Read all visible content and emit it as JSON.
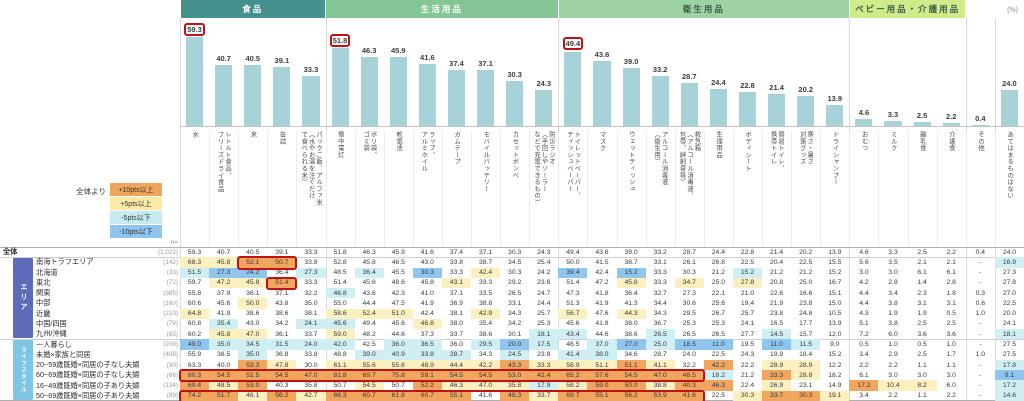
{
  "unit_label": "(%)",
  "n_label": "n=",
  "legend": {
    "prefix": "全体より",
    "items": [
      {
        "label": "+10pts以上",
        "color": "#f0a55c"
      },
      {
        "label": "+5pts以上",
        "color": "#fbe9a5"
      },
      {
        "label": "-5pts以下",
        "color": "#c3ebf1"
      },
      {
        "label": "-10pts以下",
        "color": "#8fc6f0"
      }
    ]
  },
  "chart_data": {
    "type": "bar",
    "unit": "%",
    "bar_color": "#a6d2d8",
    "annotation_color": "#bd1315",
    "groups": [
      {
        "label": "食品",
        "start": 0,
        "end": 4,
        "color": "#44918e",
        "text_color": "#ffffff"
      },
      {
        "label": "生活用品",
        "start": 5,
        "end": 12,
        "color": "#83c694",
        "text_color": "#ffffff"
      },
      {
        "label": "衛生用品",
        "start": 13,
        "end": 22,
        "color": "#9dd3a3",
        "text_color": "#3e5b45"
      },
      {
        "label": "ベビー用品・介護用品",
        "start": 23,
        "end": 26,
        "color": "#cfec8b",
        "text_color": "#3e5b45"
      }
    ],
    "categories": [
      "水",
      "レトルト食品、\nフリーズドライ食品",
      "米",
      "缶詰",
      "パックご飯、アルファ米\n（水やお湯を注ぐだけ\nで食べられる米）",
      "懐中電灯",
      "ポリ袋、\nゴミ袋",
      "乾電池",
      "ラップ、\nアルミホイル",
      "ガムテープ",
      "モバイルバッテリー",
      "カセットボンベ",
      "防災ラジオ\n（手回しやソーラー\nなどで充電できるもの）",
      "トイレットペーパー、\nティッシュペーパー",
      "マスク",
      "ウェットティッシュ",
      "アルコール消毒液\n（衛生用）",
      "救急箱\n（アルコール消毒液、\n包帯、絆創膏等）",
      "生理用品",
      "ボディシート",
      "簡易トイレ、\n携帯トイレ",
      "寒さ・暑さ\n対策グッズ",
      "ドライシャンプー",
      "おむつ",
      "ミルク",
      "離乳食",
      "介護食",
      "その他",
      "あてはまるものはない"
    ],
    "values": [
      59.3,
      40.7,
      40.5,
      39.1,
      33.3,
      51.8,
      46.3,
      45.9,
      41.6,
      37.4,
      37.1,
      30.3,
      24.3,
      49.4,
      43.6,
      39.0,
      33.2,
      28.7,
      24.4,
      22.8,
      21.4,
      20.2,
      13.9,
      4.6,
      3.3,
      2.5,
      2.2,
      0.4,
      24.0
    ],
    "bar_annotated_cols": [
      0,
      5,
      13
    ],
    "ylim": [
      0,
      65
    ]
  },
  "table": {
    "row_groups": [
      {
        "label": "エリア",
        "color": "#5e6cb8",
        "start": 1,
        "end": 8
      },
      {
        "label": "ライフスタイル",
        "color": "#7fc6e6",
        "start": 9,
        "end": 14
      }
    ],
    "rows": [
      {
        "label": "全体",
        "n": "(1,022)",
        "values": [
          59.3,
          40.7,
          40.5,
          39.1,
          33.3,
          51.8,
          46.3,
          45.9,
          41.6,
          37.4,
          37.1,
          30.3,
          24.3,
          49.4,
          43.6,
          39.0,
          33.2,
          28.7,
          24.4,
          22.8,
          21.4,
          20.2,
          13.9,
          4.6,
          3.3,
          2.5,
          2.2,
          0.4,
          24.0
        ]
      },
      {
        "label": "南海トラフエリア",
        "n": "(142)",
        "values": [
          68.3,
          45.8,
          52.1,
          50.7,
          33.8,
          52.8,
          45.8,
          46.5,
          43.0,
          33.8,
          38.7,
          34.5,
          25.4,
          50.0,
          41.5,
          38.7,
          33.1,
          26.1,
          26.8,
          22.5,
          20.4,
          22.5,
          15.5,
          5.6,
          3.5,
          2.1,
          2.1,
          "-",
          16.9
        ]
      },
      {
        "label": "北海道",
        "n": "(33)",
        "values": [
          51.5,
          27.3,
          24.2,
          36.4,
          27.3,
          48.5,
          36.4,
          45.5,
          30.3,
          33.3,
          42.4,
          30.3,
          24.2,
          39.4,
          42.4,
          15.2,
          33.3,
          30.3,
          21.2,
          15.2,
          21.2,
          21.2,
          15.2,
          3.0,
          3.0,
          6.1,
          6.1,
          "-",
          27.3
        ]
      },
      {
        "label": "東北",
        "n": "(72)",
        "values": [
          59.7,
          47.2,
          45.8,
          51.4,
          33.3,
          51.4,
          45.8,
          48.6,
          45.8,
          43.1,
          33.3,
          29.2,
          23.6,
          51.4,
          47.2,
          45.8,
          33.3,
          34.7,
          25.0,
          27.8,
          20.8,
          25.0,
          16.7,
          4.2,
          2.8,
          1.4,
          2.8,
          "-",
          27.8
        ]
      },
      {
        "label": "関東",
        "n": "(385)",
        "values": [
          55.8,
          37.9,
          36.1,
          37.1,
          32.2,
          46.8,
          43.6,
          42.3,
          41.0,
          37.1,
          33.5,
          26.5,
          24.7,
          47.3,
          41.8,
          36.4,
          32.7,
          27.3,
          22.1,
          21.0,
          22.6,
          16.6,
          15.1,
          4.4,
          3.4,
          2.3,
          1.8,
          0.3,
          27.0
        ]
      },
      {
        "label": "中部",
        "n": "(160)",
        "values": [
          60.6,
          45.6,
          50.0,
          43.8,
          35.0,
          55.0,
          44.4,
          47.5,
          41.9,
          36.9,
          38.8,
          33.1,
          24.4,
          51.3,
          41.9,
          41.3,
          34.4,
          30.6,
          25.6,
          19.4,
          21.9,
          23.8,
          15.0,
          4.4,
          3.8,
          3.1,
          3.1,
          0.6,
          22.5
        ]
      },
      {
        "label": "近畿",
        "n": "(210)",
        "values": [
          64.8,
          41.9,
          38.6,
          38.6,
          38.1,
          58.6,
          52.4,
          51.0,
          42.4,
          38.1,
          42.9,
          34.3,
          25.7,
          56.7,
          47.6,
          44.3,
          34.3,
          29.5,
          26.7,
          25.7,
          23.8,
          24.8,
          10.5,
          4.3,
          1.9,
          1.9,
          0.5,
          1.0,
          20.0
        ]
      },
      {
        "label": "中国/四国",
        "n": "(79)",
        "values": [
          60.8,
          35.4,
          43.0,
          34.2,
          24.1,
          45.6,
          49.4,
          45.6,
          46.8,
          38.0,
          35.4,
          34.2,
          25.3,
          45.6,
          41.8,
          38.0,
          36.7,
          25.3,
          25.3,
          24.1,
          16.5,
          17.7,
          13.9,
          5.1,
          3.8,
          2.5,
          2.5,
          "-",
          24.1
        ]
      },
      {
        "label": "九州/沖縄",
        "n": "(83)",
        "values": [
          60.2,
          45.8,
          47.0,
          36.1,
          33.7,
          59.0,
          48.2,
          44.6,
          37.3,
          33.7,
          38.6,
          30.1,
          18.1,
          43.4,
          44.6,
          38.6,
          26.5,
          26.5,
          26.5,
          27.7,
          14.5,
          15.7,
          12.0,
          7.2,
          6.0,
          3.6,
          3.6,
          "-",
          18.1
        ]
      },
      {
        "label": "一人暮らし",
        "n": "(200)",
        "values": [
          49.0,
          35.0,
          34.5,
          31.5,
          24.0,
          42.0,
          42.5,
          36.0,
          36.5,
          36.0,
          29.5,
          20.0,
          17.5,
          46.5,
          37.0,
          27.0,
          25.0,
          18.5,
          11.0,
          19.5,
          11.0,
          11.5,
          9.0,
          0.5,
          1.0,
          0.5,
          1.0,
          "-",
          27.5
        ]
      },
      {
        "label": "未婚×家族と同居",
        "n": "(408)",
        "values": [
          55.9,
          38.5,
          35.0,
          36.8,
          33.8,
          48.8,
          39.0,
          40.9,
          33.8,
          28.7,
          34.3,
          24.5,
          23.8,
          41.4,
          38.0,
          34.6,
          28.7,
          24.0,
          22.5,
          24.3,
          19.9,
          18.4,
          15.2,
          3.4,
          2.9,
          2.5,
          1.7,
          1.0,
          27.5
        ]
      },
      {
        "label": "20~59歳既婚×同居の子なし夫婦",
        "n": "(90)",
        "values": [
          63.3,
          40.0,
          53.3,
          47.8,
          30.0,
          61.1,
          55.6,
          55.6,
          48.9,
          44.4,
          42.2,
          43.3,
          33.3,
          58.9,
          51.1,
          51.1,
          41.1,
          32.2,
          42.2,
          22.2,
          28.9,
          28.9,
          12.2,
          2.2,
          2.2,
          1.1,
          1.1,
          "-",
          17.8
        ]
      },
      {
        "label": "60~69歳既婚×同居の子なし夫婦",
        "n": "(66)",
        "values": [
          80.3,
          54.5,
          51.5,
          54.5,
          47.0,
          81.8,
          69.7,
          75.8,
          59.1,
          54.5,
          54.5,
          53.0,
          42.4,
          65.2,
          57.6,
          54.5,
          47.0,
          48.5,
          18.2,
          21.2,
          33.3,
          28.8,
          18.2,
          6.1,
          3.0,
          3.0,
          3.0,
          "-",
          9.1
        ]
      },
      {
        "label": "16~49歳既婚×同居の子あり夫婦",
        "n": "(134)",
        "values": [
          69.4,
          48.5,
          53.0,
          40.3,
          35.8,
          50.7,
          54.5,
          50.7,
          52.2,
          46.3,
          47.0,
          35.8,
          17.9,
          58.2,
          59.0,
          50.0,
          38.8,
          40.3,
          46.3,
          22.4,
          26.9,
          23.1,
          14.9,
          17.2,
          10.4,
          8.2,
          6.0,
          "-",
          17.2
        ]
      },
      {
        "label": "50~69歳既婚×同居の子あり夫婦",
        "n": "(89)",
        "values": [
          74.2,
          51.7,
          46.1,
          56.2,
          42.7,
          66.3,
          60.7,
          61.8,
          60.7,
          55.1,
          41.6,
          48.3,
          33.7,
          69.7,
          55.1,
          56.2,
          53.9,
          41.6,
          22.5,
          30.3,
          33.7,
          30.3,
          19.1,
          3.4,
          2.2,
          1.1,
          2.2,
          "-",
          14.6
        ]
      }
    ],
    "cell_annotations": [
      {
        "row": 1,
        "col_start": 2,
        "col_end": 3
      },
      {
        "row": 3,
        "col_start": 3,
        "col_end": 3
      },
      {
        "row": 12,
        "col_start": 0,
        "col_end": 17
      },
      {
        "row": 14,
        "col_start": 0,
        "col_end": 17
      }
    ]
  }
}
